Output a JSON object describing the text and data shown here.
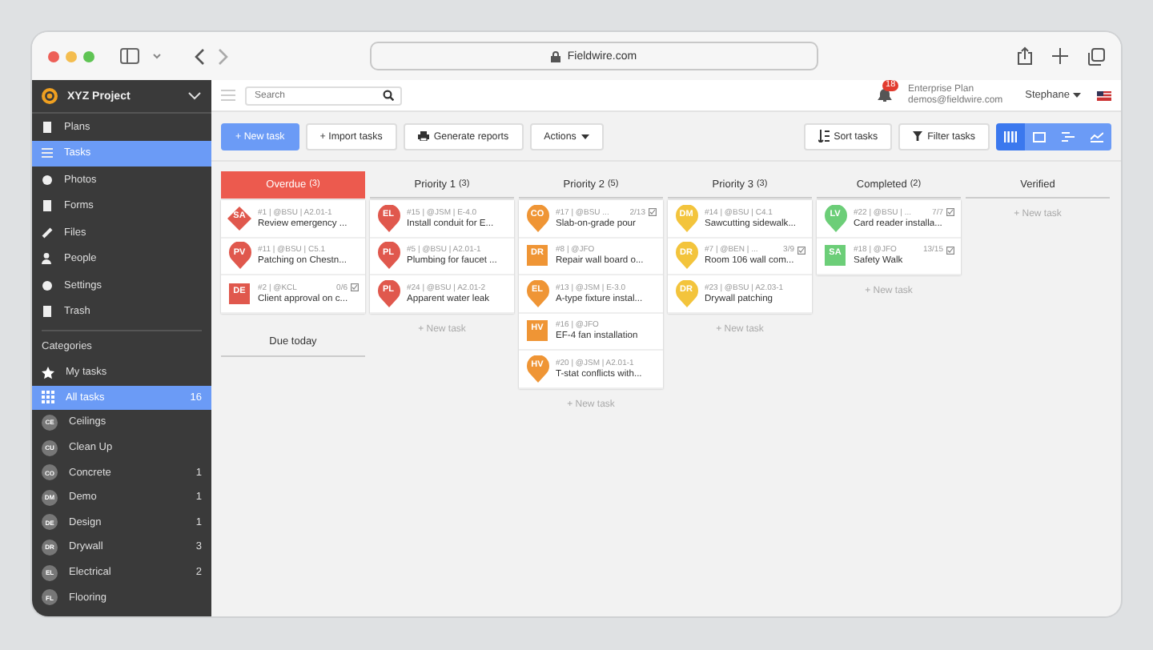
{
  "browser": {
    "url": "Fieldwire.com"
  },
  "sidebar": {
    "project": "XYZ Project",
    "nav": [
      {
        "label": "Plans",
        "selected": false
      },
      {
        "label": "Tasks",
        "selected": true
      },
      {
        "label": "Photos",
        "selected": false
      },
      {
        "label": "Forms",
        "selected": false
      },
      {
        "label": "Files",
        "selected": false
      },
      {
        "label": "People",
        "selected": false
      },
      {
        "label": "Settings",
        "selected": false
      },
      {
        "label": "Trash",
        "selected": false
      }
    ],
    "categories_title": "Categories",
    "categories": [
      {
        "kind": "star",
        "label": "My tasks",
        "selected": false
      },
      {
        "kind": "grid",
        "label": "All tasks",
        "count": "16",
        "selected": true
      },
      {
        "kind": "badge",
        "badge": "CE",
        "label": "Ceilings",
        "selected": false
      },
      {
        "kind": "badge",
        "badge": "CU",
        "label": "Clean Up",
        "selected": false
      },
      {
        "kind": "badge",
        "badge": "CO",
        "label": "Concrete",
        "count": "1",
        "selected": false
      },
      {
        "kind": "badge",
        "badge": "DM",
        "label": "Demo",
        "count": "1",
        "selected": false
      },
      {
        "kind": "badge",
        "badge": "DE",
        "label": "Design",
        "count": "1",
        "selected": false
      },
      {
        "kind": "badge",
        "badge": "DR",
        "label": "Drywall",
        "count": "3",
        "selected": false
      },
      {
        "kind": "badge",
        "badge": "EL",
        "label": "Electrical",
        "count": "2",
        "selected": false
      },
      {
        "kind": "badge",
        "badge": "FL",
        "label": "Flooring",
        "selected": false
      }
    ]
  },
  "topbar": {
    "search_placeholder": "Search",
    "notifications": "18",
    "plan": "Enterprise Plan",
    "email": "demos@fieldwire.com",
    "user": "Stephane"
  },
  "toolbar": {
    "new_task": "+ New task",
    "import": "+ Import tasks",
    "reports": "Generate reports",
    "actions": "Actions",
    "sort": "Sort tasks",
    "filter": "Filter tasks",
    "views": [
      {
        "selected": true
      },
      {
        "selected": false
      },
      {
        "selected": false
      },
      {
        "selected": false
      }
    ]
  },
  "columns": [
    {
      "kind": "overdue",
      "title": "Overdue",
      "count": "(3)",
      "tasks": [
        {
          "kind": "diamond",
          "color": "#e0584d",
          "initials": "SA",
          "meta": "#1 | @BSU | A2.01-1",
          "title": "Review emergency ..."
        },
        {
          "kind": "pin",
          "color": "#e0584d",
          "initials": "PV",
          "meta": "#11 | @BSU | C5.1",
          "title": "Patching on Chestn..."
        },
        {
          "kind": "square",
          "color": "#e0584d",
          "initials": "DE",
          "meta": "#2 | @KCL",
          "progress": "0/6",
          "title": "Client approval on c..."
        }
      ],
      "subgroup": "Due today"
    },
    {
      "kind": "status",
      "title": "Priority 1",
      "count": "(3)",
      "tasks": [
        {
          "kind": "pin",
          "color": "#e0584d",
          "initials": "EL",
          "meta": "#15 | @JSM | E-4.0",
          "title": "Install conduit for E..."
        },
        {
          "kind": "pin",
          "color": "#e0584d",
          "initials": "PL",
          "meta": "#5 | @BSU | A2.01-1",
          "title": "Plumbing for faucet ..."
        },
        {
          "kind": "pin",
          "color": "#e0584d",
          "initials": "PL",
          "meta": "#24 | @BSU | A2.01-2",
          "title": "Apparent water leak"
        }
      ],
      "new_task": "+ New task"
    },
    {
      "kind": "status",
      "title": "Priority 2",
      "count": "(5)",
      "tasks": [
        {
          "kind": "pin",
          "color": "#ef9535",
          "initials": "CO",
          "meta": "#17 | @BSU ...",
          "progress": "2/13",
          "title": "Slab-on-grade pour"
        },
        {
          "kind": "square",
          "color": "#ef9535",
          "initials": "DR",
          "meta": "#8 | @JFO",
          "title": "Repair wall board o..."
        },
        {
          "kind": "pin",
          "color": "#ef9535",
          "initials": "EL",
          "meta": "#13 | @JSM | E-3.0",
          "title": "A-type fixture instal..."
        },
        {
          "kind": "square",
          "color": "#ef9535",
          "initials": "HV",
          "meta": "#16 | @JFO",
          "title": "EF-4 fan installation"
        },
        {
          "kind": "pin",
          "color": "#ef9535",
          "initials": "HV",
          "meta": "#20 | @JSM | A2.01-1",
          "title": "T-stat conflicts with..."
        }
      ],
      "new_task": "+ New task"
    },
    {
      "kind": "status",
      "title": "Priority 3",
      "count": "(3)",
      "tasks": [
        {
          "kind": "pin",
          "color": "#f3c43c",
          "initials": "DM",
          "meta": "#14 | @BSU | C4.1",
          "title": "Sawcutting sidewalk..."
        },
        {
          "kind": "pin",
          "color": "#f3c43c",
          "initials": "DR",
          "meta": "#7 | @BEN | ...",
          "progress": "3/9",
          "title": "Room 106 wall com..."
        },
        {
          "kind": "pin",
          "color": "#f3c43c",
          "initials": "DR",
          "meta": "#23 | @BSU | A2.03-1",
          "title": "Drywall patching"
        }
      ],
      "new_task": "+ New task"
    },
    {
      "kind": "status",
      "title": "Completed",
      "count": "(2)",
      "tasks": [
        {
          "kind": "pin",
          "color": "#6cce78",
          "initials": "LV",
          "meta": "#22 | @BSU | ...",
          "progress": "7/7",
          "title": "Card reader installa..."
        },
        {
          "kind": "square",
          "color": "#6cce78",
          "initials": "SA",
          "meta": "#18 | @JFO",
          "progress": "13/15",
          "title": "Safety Walk"
        }
      ],
      "new_task": "+ New task"
    },
    {
      "kind": "status",
      "title": "Verified",
      "new_task": "+ New task"
    }
  ]
}
